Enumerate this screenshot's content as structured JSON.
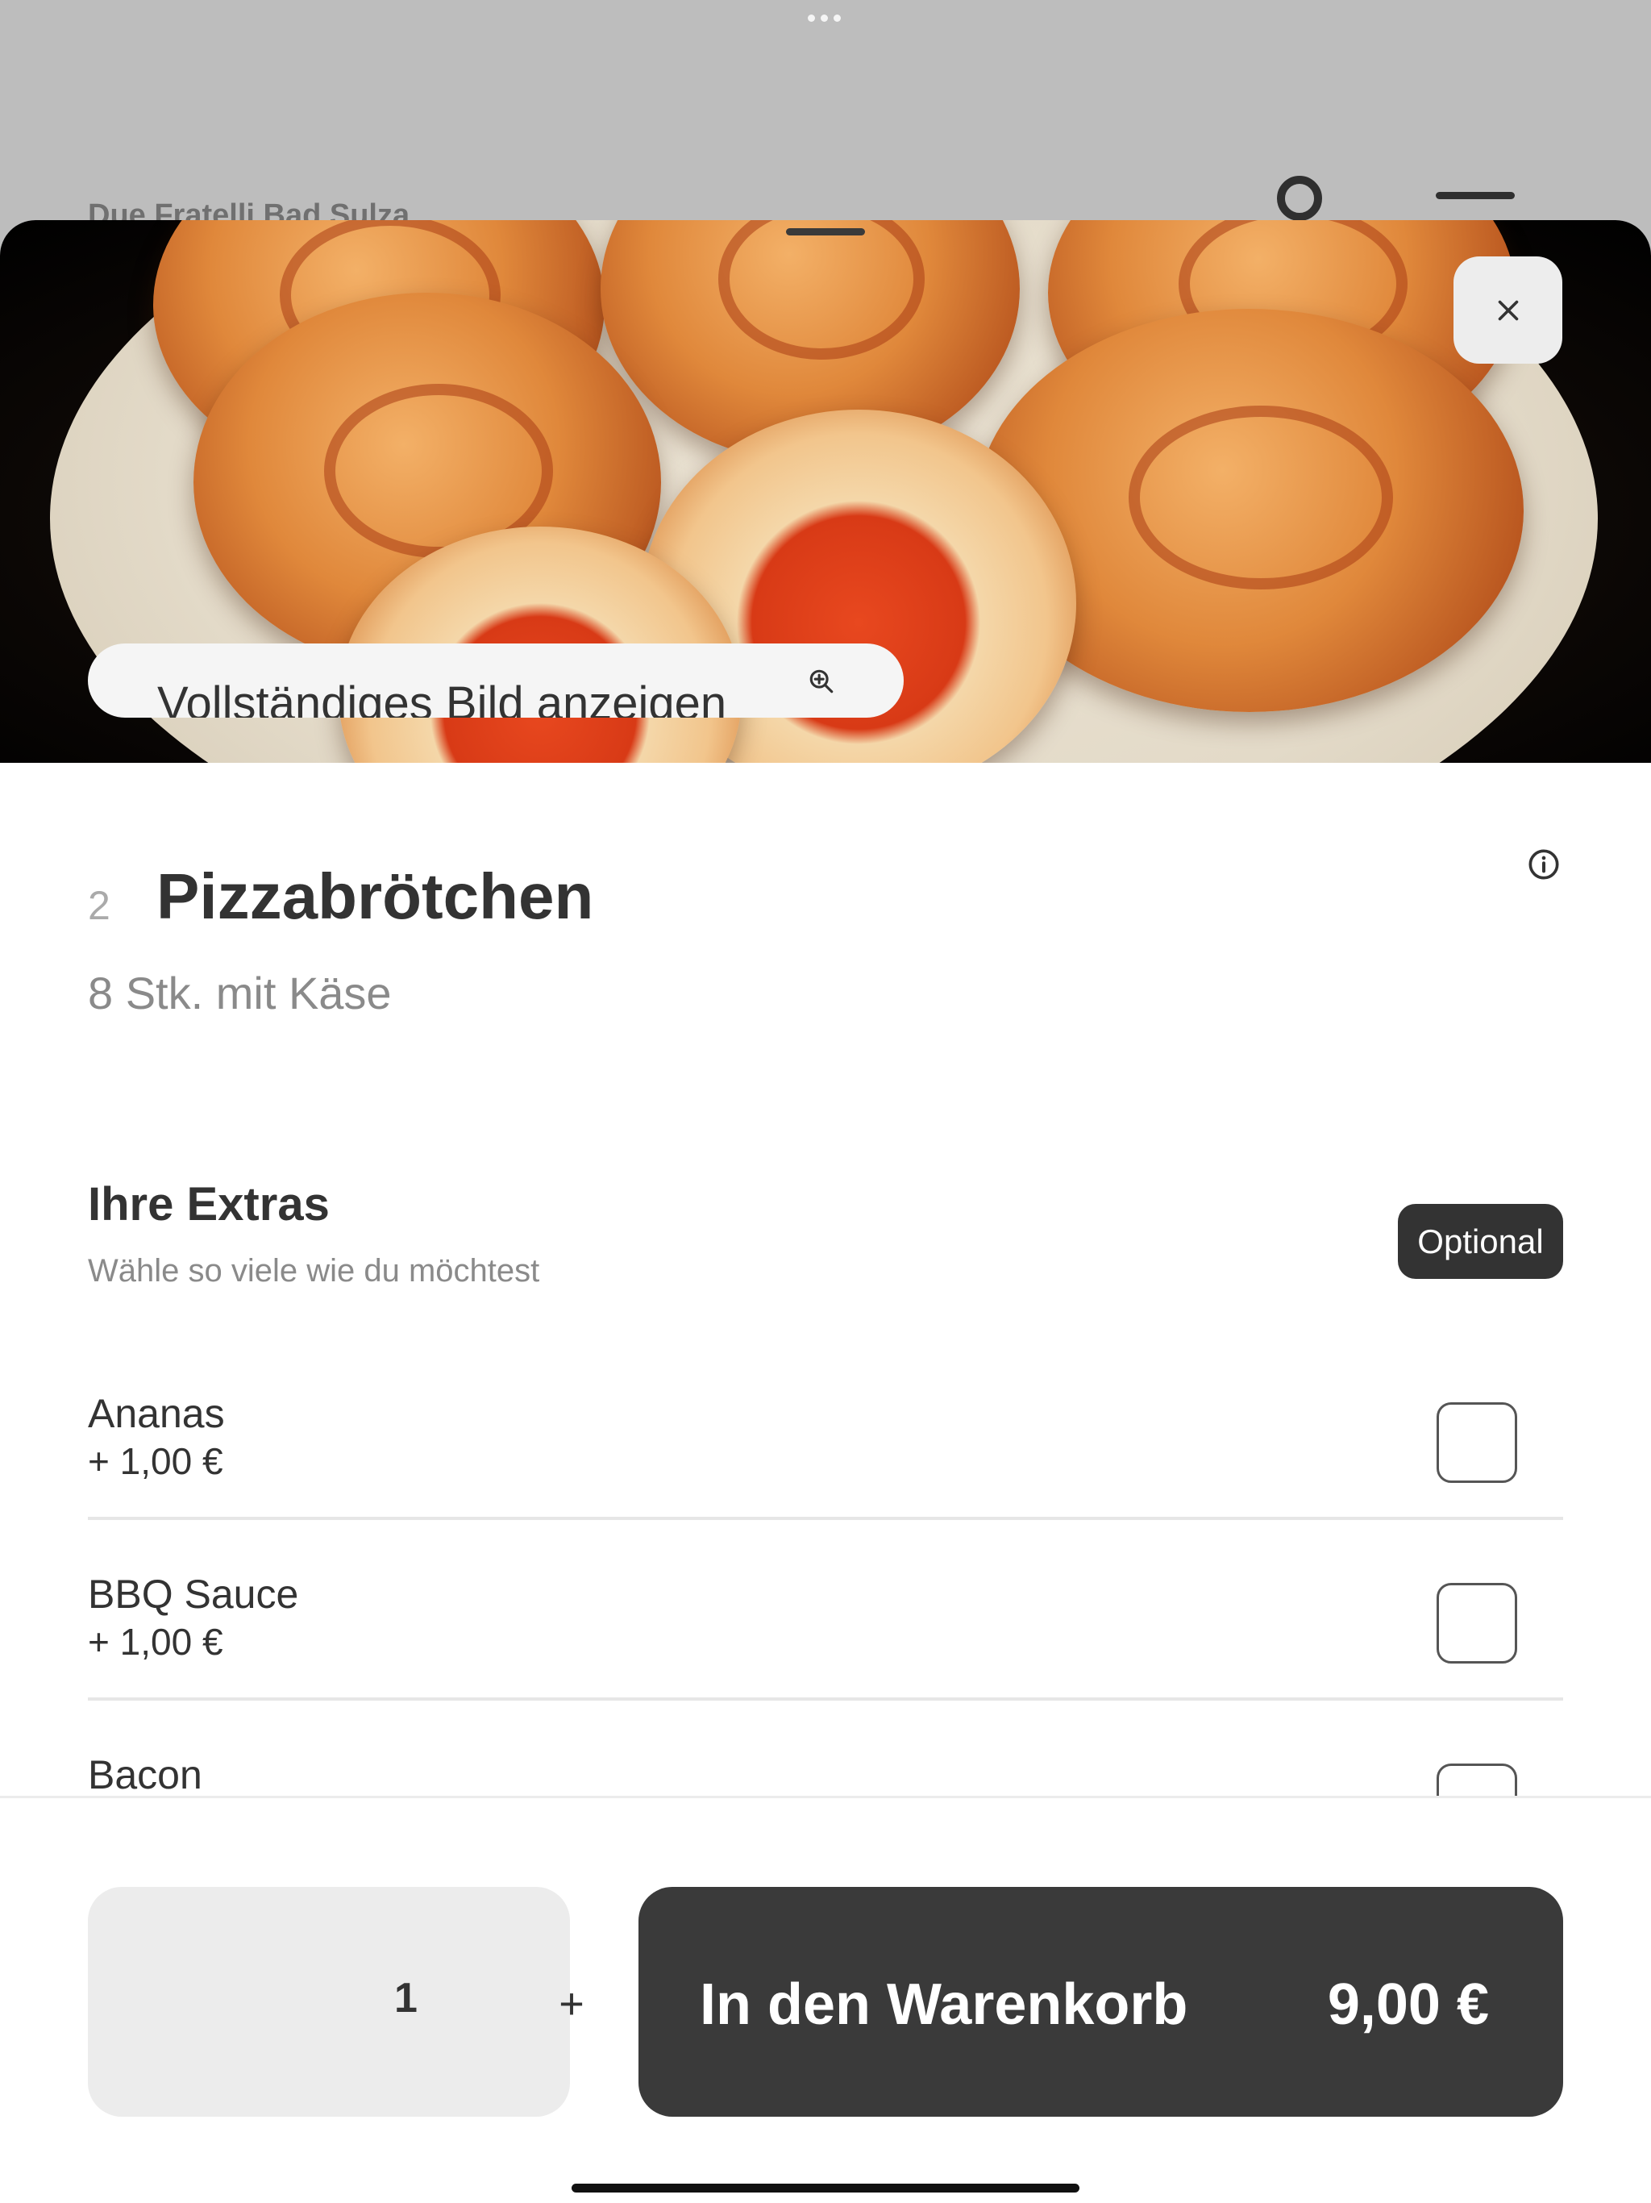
{
  "background": {
    "restaurant_name": "Due Fratelli Bad Sulza"
  },
  "modal": {
    "full_image_label": "Vollständiges Bild anzeigen",
    "close_icon": "close-icon",
    "zoom_icon": "zoom-in-icon"
  },
  "product": {
    "number": "2",
    "name": "Pizzabrötchen",
    "description": "8 Stk. mit Käse",
    "info_icon": "info-icon"
  },
  "extras": {
    "title": "Ihre Extras",
    "subtitle": "Wähle so viele wie du möchtest",
    "badge": "Optional",
    "items": [
      {
        "name": "Ananas",
        "price": "+ 1,00 €",
        "checked": false
      },
      {
        "name": "BBQ Sauce",
        "price": "+ 1,00 €",
        "checked": false
      },
      {
        "name": "Bacon",
        "price": "",
        "checked": false
      }
    ]
  },
  "footer": {
    "quantity": "1",
    "plus_label": "+",
    "cart_label": "In den Warenkorb",
    "cart_price": "9,00 €"
  },
  "colors": {
    "dark": "#3a3a3a",
    "muted_text": "#8a8a8a",
    "overlay": "#bdbdbd"
  }
}
